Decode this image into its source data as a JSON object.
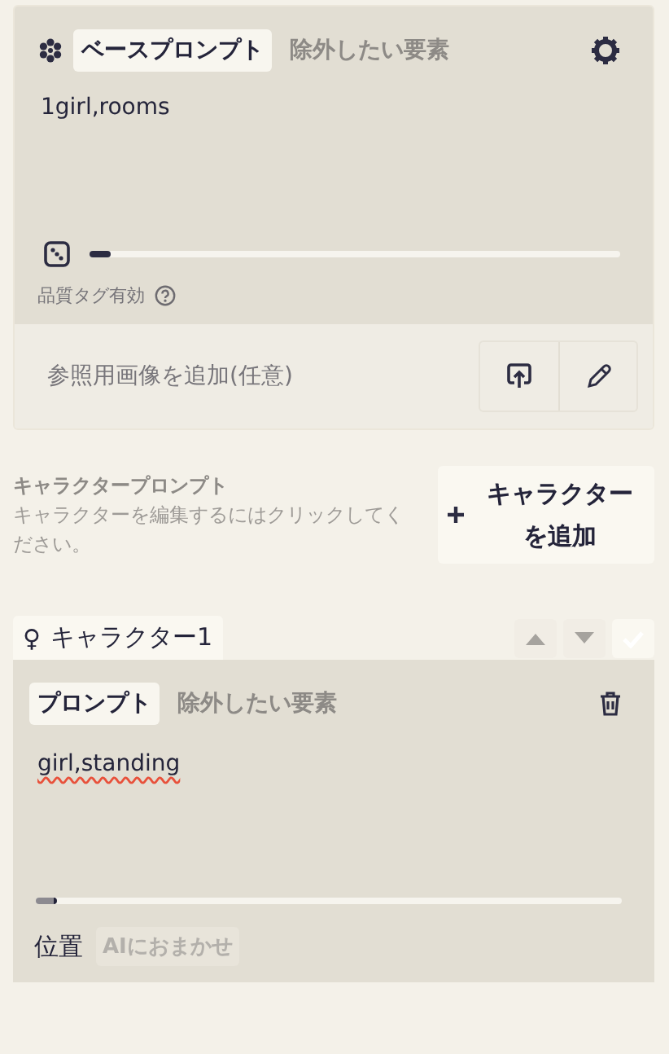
{
  "base_prompt": {
    "tabs": [
      {
        "label": "ベースプロンプト",
        "selected": true
      },
      {
        "label": "除外したい要素",
        "selected": false
      }
    ],
    "text": "1girl,rooms",
    "slider": {
      "level": 0.04
    },
    "quality_label": "品質タグ有効"
  },
  "reference": {
    "label": "参照用画像を追加(任意)"
  },
  "character_prompt": {
    "title": "キャラクタープロンプト",
    "hint": "キャラクターを編集するにはクリックしてください。",
    "add_button": "キャラクターを追加"
  },
  "characters": [
    {
      "symbol": "♀",
      "name": "キャラクター1",
      "tabs": [
        {
          "label": "プロンプト",
          "selected": true
        },
        {
          "label": "除外したい要素",
          "selected": false
        }
      ],
      "text": "girl,standing",
      "slider": {
        "level": 0.03
      },
      "position_label": "位置",
      "position_value": "AIにおまかせ"
    }
  ]
}
